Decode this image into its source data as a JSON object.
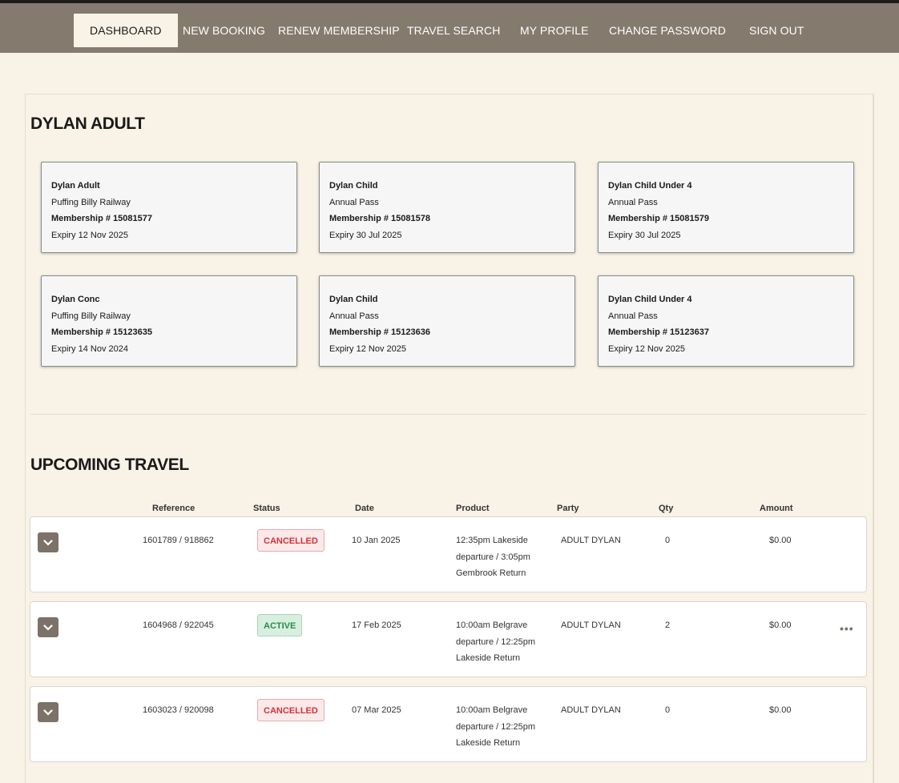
{
  "nav": {
    "items": [
      "DASHBOARD",
      "NEW BOOKING",
      "RENEW MEMBERSHIP",
      "TRAVEL SEARCH",
      "MY PROFILE",
      "CHANGE PASSWORD",
      "SIGN OUT"
    ]
  },
  "memberships": {
    "title": "DYLAN ADULT",
    "cards": [
      {
        "name": "Dylan Adult",
        "type": "Puffing Billy Railway",
        "membership": "Membership # 15081577",
        "expiry": "Expiry 12 Nov 2025"
      },
      {
        "name": "Dylan Child",
        "type": "Annual Pass",
        "membership": "Membership # 15081578",
        "expiry": "Expiry 30 Jul 2025"
      },
      {
        "name": "Dylan Child Under 4",
        "type": "Annual Pass",
        "membership": "Membership # 15081579",
        "expiry": "Expiry 30 Jul 2025"
      },
      {
        "name": "Dylan Conc",
        "type": "Puffing Billy Railway",
        "membership": "Membership # 15123635",
        "expiry": "Expiry 14 Nov 2024"
      },
      {
        "name": "Dylan Child",
        "type": "Annual Pass",
        "membership": "Membership # 15123636",
        "expiry": "Expiry 12 Nov 2025"
      },
      {
        "name": "Dylan Child Under 4",
        "type": "Annual Pass",
        "membership": "Membership # 15123637",
        "expiry": "Expiry 12 Nov 2025"
      }
    ]
  },
  "travel": {
    "title": "UPCOMING TRAVEL",
    "headers": [
      "Reference",
      "Status",
      "Date",
      "Product",
      "Party",
      "Qty",
      "Amount"
    ],
    "rows": [
      {
        "reference": "1601789 / 918862",
        "status": "CANCELLED",
        "date": "10 Jan 2025",
        "product": [
          "12:35pm Lakeside",
          "departure / 3:05pm",
          "Gembrook Return"
        ],
        "party": "ADULT DYLAN",
        "qty": "0",
        "amount": "$0.00"
      },
      {
        "reference": "1604968 / 922045",
        "status": "ACTIVE",
        "date": "17 Feb 2025",
        "product": [
          "10:00am Belgrave",
          "departure / 12:25pm",
          "Lakeside Return"
        ],
        "party": "ADULT DYLAN",
        "qty": "2",
        "amount": "$0.00",
        "actions": "•••"
      },
      {
        "reference": "1603023 / 920098",
        "status": "CANCELLED",
        "date": "07 Mar 2025",
        "product": [
          "10:00am Belgrave",
          "departure / 12:25pm",
          "Lakeside Return"
        ],
        "party": "ADULT DYLAN",
        "qty": "0",
        "amount": "$0.00"
      }
    ]
  },
  "colors": {
    "nav_bg": "#857a6e",
    "page_bg": "#f8f3e6",
    "cancelled": "#d2323c",
    "active": "#2c8a4c"
  }
}
